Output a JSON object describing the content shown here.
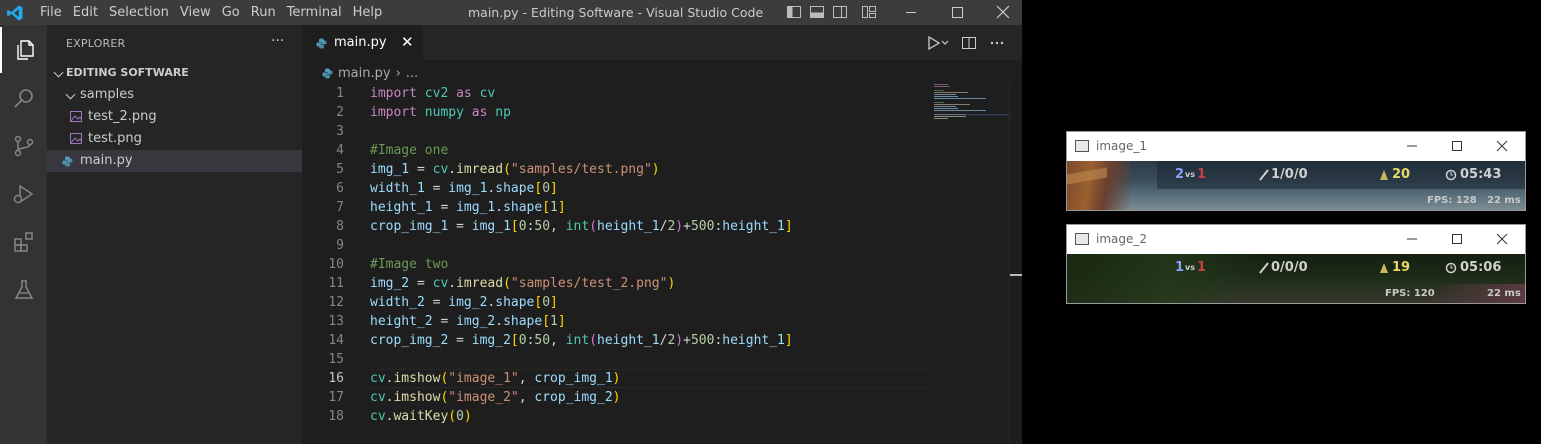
{
  "titlebar": {
    "menu": [
      "File",
      "Edit",
      "Selection",
      "View",
      "Go",
      "Run",
      "Terminal",
      "Help"
    ],
    "title": "main.py - Editing Software - Visual Studio Code"
  },
  "sidebar": {
    "title": "EXPLORER",
    "more": "···",
    "folder": "EDITING SOFTWARE",
    "subfolder": "samples",
    "files": [
      "test_2.png",
      "test.png"
    ],
    "root_file": "main.py"
  },
  "editor": {
    "tab_label": "main.py",
    "tab_close": "✕",
    "breadcrumb_file": "main.py",
    "breadcrumb_sep": "›",
    "breadcrumb_more": "...",
    "active_line": 16,
    "line_numbers": [
      "1",
      "2",
      "3",
      "4",
      "5",
      "6",
      "7",
      "8",
      "9",
      "10",
      "11",
      "12",
      "13",
      "14",
      "15",
      "16",
      "17",
      "18"
    ]
  },
  "cv_windows": [
    {
      "title": "image_1",
      "hud": {
        "left_score": "2",
        "right_score": "1",
        "kda": "1/0/0",
        "cs": "20",
        "time": "05:43",
        "fps": "FPS: 128",
        "ping": "22 ms"
      }
    },
    {
      "title": "image_2",
      "hud": {
        "left_score": "1",
        "right_score": "1",
        "kda": "0/0/0",
        "cs": "19",
        "time": "05:06",
        "fps": "FPS: 120",
        "ping": "22 ms"
      }
    }
  ],
  "colors": {
    "vscode_blue": "#23a9f2",
    "editor_bg": "#1e1e1e",
    "sidebar_bg": "#252526",
    "activity_bg": "#333333",
    "titlebar_bg": "#3c3c3c"
  }
}
